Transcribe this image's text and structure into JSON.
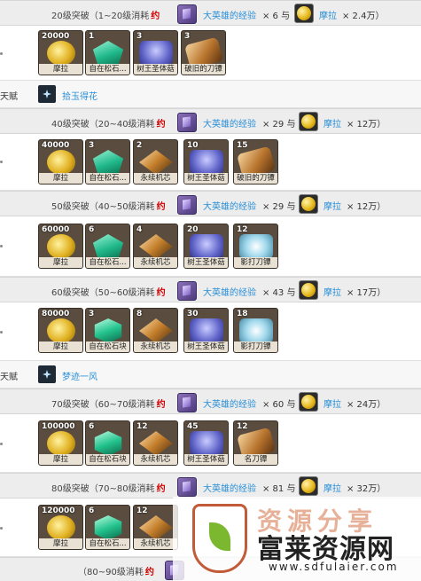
{
  "rows": [
    {
      "stage": "20级突破（1~20级消耗",
      "yue": "约",
      "hero": "大英雄的经验",
      "hero_count": "× 6 与",
      "mora": "摩拉",
      "mora_count": "× 2.4万）"
    },
    {
      "stage": "40级突破（20~40级消耗",
      "yue": "约",
      "hero": "大英雄的经验",
      "hero_count": "× 29 与",
      "mora": "摩拉",
      "mora_count": "× 12万）"
    },
    {
      "stage": "50级突破（40~50级消耗",
      "yue": "约",
      "hero": "大英雄的经验",
      "hero_count": "× 29 与",
      "mora": "摩拉",
      "mora_count": "× 12万）"
    },
    {
      "stage": "60级突破（50~60级消耗",
      "yue": "约",
      "hero": "大英雄的经验",
      "hero_count": "× 43 与",
      "mora": "摩拉",
      "mora_count": "× 17万）"
    },
    {
      "stage": "70级突破（60~70级消耗",
      "yue": "约",
      "hero": "大英雄的经验",
      "hero_count": "× 60 与",
      "mora": "摩拉",
      "mora_count": "× 24万）"
    },
    {
      "stage": "80级突破（70~80级消耗",
      "yue": "约",
      "hero": "大英雄的经验",
      "hero_count": "× 81 与",
      "mora": "摩拉",
      "mora_count": "× 32万）"
    },
    {
      "stage": "（80~90级消耗",
      "yue": "约"
    }
  ],
  "items": [
    [
      {
        "n": "20000",
        "l": "摩拉",
        "t": "mora"
      },
      {
        "n": "1",
        "l": "自在松石...",
        "t": "jade"
      },
      {
        "n": "3",
        "l": "树王圣体菇",
        "t": "mush"
      },
      {
        "n": "3",
        "l": "破旧的刀镡",
        "t": "sword"
      }
    ],
    [
      {
        "n": "40000",
        "l": "摩拉",
        "t": "mora"
      },
      {
        "n": "3",
        "l": "自在松石...",
        "t": "jade"
      },
      {
        "n": "2",
        "l": "永续机芯",
        "t": "core"
      },
      {
        "n": "10",
        "l": "树王圣体菇",
        "t": "mush"
      },
      {
        "n": "15",
        "l": "破旧的刀镡",
        "t": "sword"
      }
    ],
    [
      {
        "n": "60000",
        "l": "摩拉",
        "t": "mora"
      },
      {
        "n": "6",
        "l": "自在松石...",
        "t": "jade"
      },
      {
        "n": "4",
        "l": "永续机芯",
        "t": "core"
      },
      {
        "n": "20",
        "l": "树王圣体菇",
        "t": "mush"
      },
      {
        "n": "12",
        "l": "影打刀镡",
        "t": "tang"
      }
    ],
    [
      {
        "n": "80000",
        "l": "摩拉",
        "t": "mora"
      },
      {
        "n": "3",
        "l": "自在松石块",
        "t": "gem"
      },
      {
        "n": "8",
        "l": "永续机芯",
        "t": "core"
      },
      {
        "n": "30",
        "l": "树王圣体菇",
        "t": "mush"
      },
      {
        "n": "18",
        "l": "影打刀镡",
        "t": "tang"
      }
    ],
    [
      {
        "n": "100000",
        "l": "摩拉",
        "t": "mora"
      },
      {
        "n": "6",
        "l": "自在松石块",
        "t": "gem"
      },
      {
        "n": "12",
        "l": "永续机芯",
        "t": "core"
      },
      {
        "n": "45",
        "l": "树王圣体菇",
        "t": "mush"
      },
      {
        "n": "12",
        "l": "名刀镡",
        "t": "sword"
      }
    ],
    [
      {
        "n": "120000",
        "l": "摩拉",
        "t": "mora"
      },
      {
        "n": "6",
        "l": "自在松石...",
        "t": "gem"
      },
      {
        "n": "12",
        "l": "永续机芯",
        "t": "core"
      }
    ]
  ],
  "talents": [
    {
      "label": "天赋",
      "name": "拾玉得花"
    },
    {
      "label": "天赋",
      "name": "梦迹一风"
    }
  ],
  "watermark": {
    "big": "资源分享",
    "brand": "富莱资源网",
    "url": "www.sdfulaier.com"
  }
}
